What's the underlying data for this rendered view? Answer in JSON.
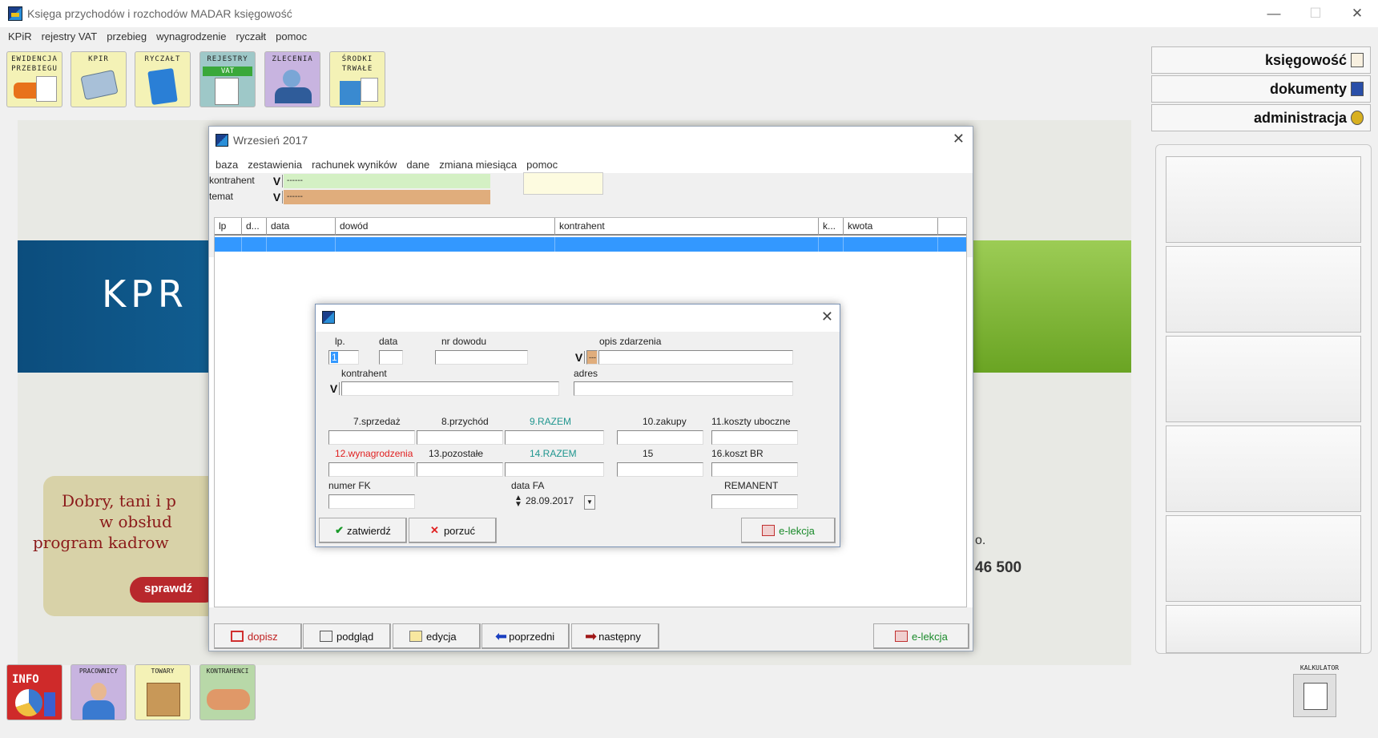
{
  "window": {
    "title": "Księga przychodów i rozchodów MADAR  księgowość",
    "controls": [
      "—",
      "☐",
      "✕"
    ]
  },
  "menu": [
    "KPiR",
    "rejestry VAT",
    "przebieg",
    "wynagrodzenie",
    "ryczałt",
    "pomoc"
  ],
  "toolbar": [
    {
      "line1": "EWIDENCJA",
      "line2": "PRZEBIEGU",
      "color": "#f4f2b6"
    },
    {
      "line1": "KPIR",
      "line2": "",
      "color": "#f4f2b6"
    },
    {
      "line1": "RYCZAŁT",
      "line2": "",
      "color": "#f4f2b6"
    },
    {
      "line1": "REJESTRY",
      "line2": "VAT",
      "color": "#9ec8c8"
    },
    {
      "line1": "ZLECENIA",
      "line2": "",
      "color": "#c8b4e0"
    },
    {
      "line1": "ŚRODKI",
      "line2": "TRWAŁE",
      "color": "#f4f2b6"
    }
  ],
  "right_panel": {
    "buttons": [
      "księgowość",
      "dokumenty",
      "administracja"
    ]
  },
  "banner": {
    "logo_text": "KPR",
    "promo_lines": [
      "Dobry, tani i p",
      "w obsłud",
      "program kadrow"
    ],
    "promo_button": "sprawdź",
    "partial_text": "o.",
    "phone_partial": "46 500"
  },
  "bottom_tiles": [
    {
      "label": "INFO",
      "color": "#cf2a2a"
    },
    {
      "label": "PRACOWNICY",
      "color": "#c8b4e0"
    },
    {
      "label": "TOWARY",
      "color": "#f4f2b6"
    },
    {
      "label": "KONTRAHENCI",
      "color": "#b8d8a8"
    }
  ],
  "calculator": {
    "label": "KALKULATOR"
  },
  "month_dialog": {
    "title": "Wrzesień  2017",
    "menu": [
      "baza",
      "zestawienia",
      "rachunek wyników",
      "dane",
      "zmiana miesiąca",
      "pomoc"
    ],
    "filters": [
      {
        "label": "kontrahent",
        "value": "------",
        "color": "#d4f0c4"
      },
      {
        "label": "temat",
        "value": "------",
        "color": "#e0ad7c"
      }
    ],
    "columns": [
      "lp",
      "d...",
      "data",
      "dowód",
      "kontrahent",
      "k...",
      "kwota"
    ],
    "buttons": [
      "dopisz",
      "podgląd",
      "edycja",
      "poprzedni",
      "następny",
      "e-lekcja"
    ]
  },
  "entry_dialog": {
    "fields": {
      "lp_label": "lp.",
      "lp_value": "1",
      "data_label": "data",
      "nr_dowodu_label": "nr dowodu",
      "opis_label": "opis zdarzenia",
      "opis_value": "---",
      "kontrahent_label": "kontrahent",
      "adres_label": "adres",
      "sprzedaz": "7.sprzedaż",
      "przychod": "8.przychód",
      "razem9": "9.RAZEM",
      "zakupy": "10.zakupy",
      "koszty": "11.koszty uboczne",
      "wynagrodzenia": "12.wynagrodzenia",
      "pozostale": "13.pozostałe",
      "razem14": "14.RAZEM",
      "col15": "15",
      "kosztbr": "16.koszt BR",
      "numer_fk": "numer FK",
      "data_fa": "data FA",
      "data_fa_value": "28.09.2017",
      "remanent": "REMANENT"
    },
    "buttons": {
      "confirm": "zatwierdź",
      "cancel": "porzuć",
      "lesson": "e-lekcja"
    }
  }
}
